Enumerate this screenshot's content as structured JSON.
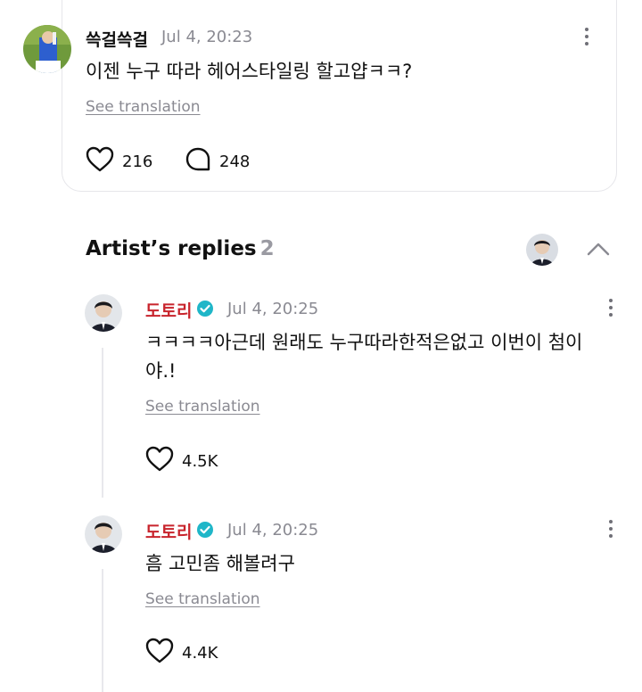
{
  "post": {
    "author": "쓱걸쓱걸",
    "time": "Jul 4, 20:23",
    "text": "이젠 누구 따라 헤어스타일링 할고얍ㅋㅋ?",
    "translate_label": "See translation",
    "likes": "216",
    "comments": "248"
  },
  "replies_section": {
    "title": "Artist’s replies",
    "count": "2"
  },
  "replies": [
    {
      "author": "도토리",
      "time": "Jul 4, 20:25",
      "text_line1": "ㅋㅋㅋㅋ아근데 원래도 누구따라한적은없고 이번이 첨이",
      "text_line2": "야.!",
      "translate_label": "See translation",
      "likes": "4.5K"
    },
    {
      "author": "도토리",
      "time": "Jul 4, 20:25",
      "text_line1": "흠 고민좀 해볼려구",
      "translate_label": "See translation",
      "likes": "4.4K"
    }
  ],
  "icons": {
    "like": "heart-icon",
    "comment": "speech-bubble-icon",
    "more": "more-vertical-icon",
    "verified": "verified-badge-icon",
    "collapse": "chevron-up-icon"
  },
  "colors": {
    "artist_name": "#c8242c",
    "verified": "#1fb6c8",
    "muted_text": "#8a8a92"
  }
}
